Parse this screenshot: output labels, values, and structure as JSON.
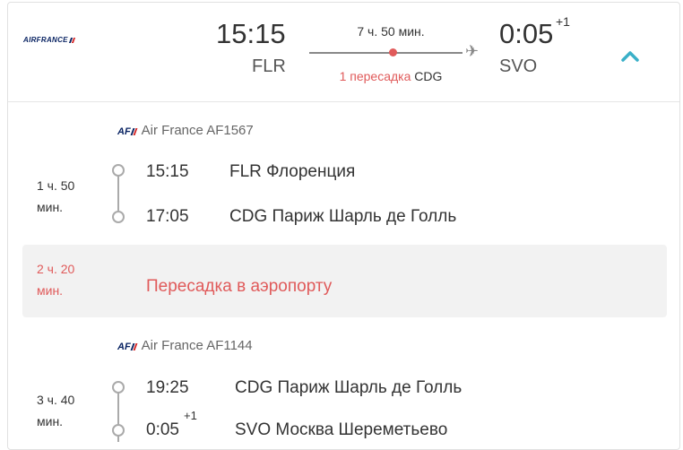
{
  "colors": {
    "accent": "#3ab0c8",
    "transfer_red": "#e05a5a",
    "airline_navy": "#0a2463"
  },
  "header": {
    "airline_logo": "AIRFRANCE",
    "departure": {
      "time": "15:15",
      "code": "FLR"
    },
    "arrival": {
      "time": "0:05",
      "day_offset": "+1",
      "code": "SVO"
    },
    "duration": "7 ч. 50 мин.",
    "transfers": {
      "count_label": "1 пересадка",
      "airport": "CDG"
    },
    "collapse_icon": "chevron-up-icon"
  },
  "segments": [
    {
      "airline_logo": "AF",
      "airline": "Air France AF1567",
      "duration_line1": "1 ч. 50",
      "duration_line2": "мин.",
      "departure": {
        "time": "15:15",
        "airport": "FLR Флоренция"
      },
      "arrival": {
        "time": "17:05",
        "airport": "CDG Париж Шарль де Голль"
      }
    },
    {
      "airline_logo": "AF",
      "airline": "Air France AF1144",
      "duration_line1": "3 ч. 40",
      "duration_line2": "мин.",
      "departure": {
        "time": "19:25",
        "airport": "CDG Париж Шарль де Голль"
      },
      "arrival": {
        "time": "0:05",
        "day_offset": "+1",
        "airport": "SVO Москва Шереметьево"
      }
    }
  ],
  "layover": {
    "duration_line1": "2 ч. 20",
    "duration_line2": "мин.",
    "text": "Пересадка в аэропорту"
  }
}
